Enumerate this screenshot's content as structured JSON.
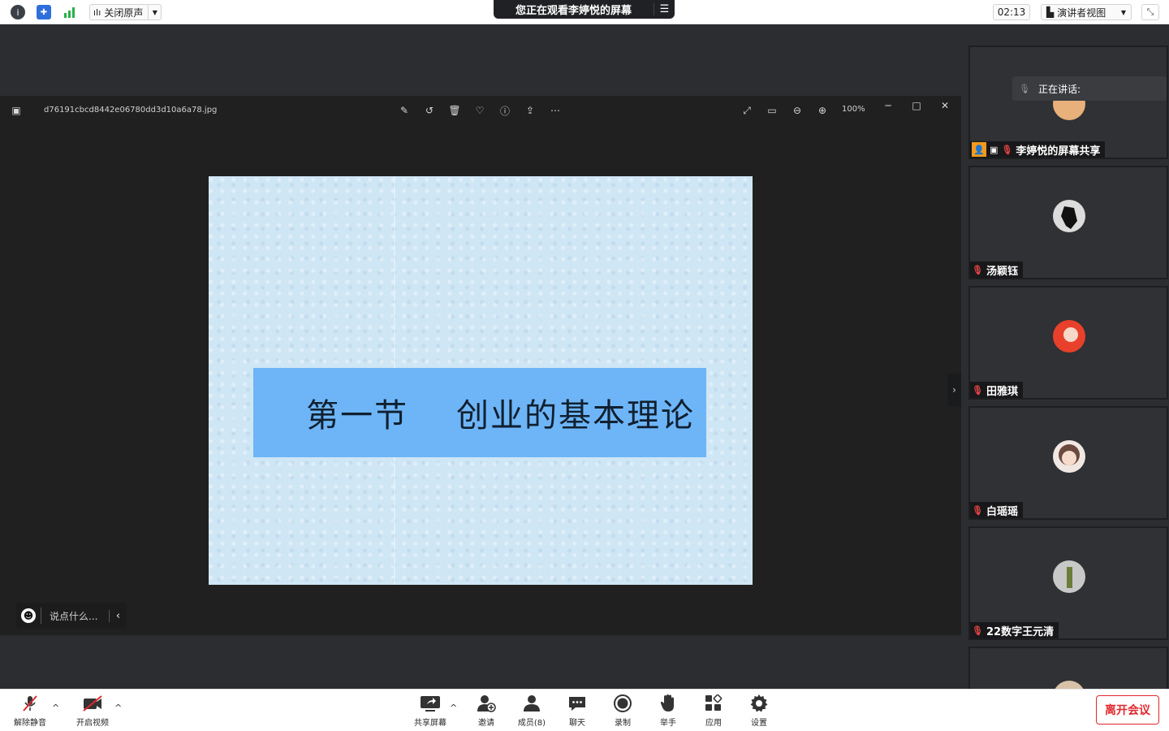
{
  "topbar": {
    "audio_label": "关闭原声",
    "share_banner": "您正在观看李婷悦的屏幕",
    "timer": "02:13",
    "view_label": "演讲者视图"
  },
  "viewer": {
    "filename": "d76191cbcd8442e06780dd3d10a6a78.jpg",
    "zoom": "100%",
    "slide_title": "第一节    创业的基本理论",
    "chat_placeholder": "说点什么..."
  },
  "panel": {
    "speaking_label": "正在讲话:",
    "participants": [
      {
        "name": "李婷悦的屏幕共享"
      },
      {
        "name": "汤颖钰"
      },
      {
        "name": "田雅琪"
      },
      {
        "name": "白瑶瑶"
      },
      {
        "name": "22数字王元清"
      }
    ]
  },
  "toolbar": {
    "unmute": "解除静音",
    "start_video": "开启视频",
    "share_screen": "共享屏幕",
    "invite": "邀请",
    "members": "成员(8)",
    "chat": "聊天",
    "record": "录制",
    "raise_hand": "举手",
    "apps": "应用",
    "settings": "设置",
    "leave": "离开会议"
  },
  "colors": {
    "leave": "#e0282e",
    "title_band": "#6eb5f7",
    "slide_bg": "#cfe6f5",
    "mic_muted": "#e04444"
  }
}
